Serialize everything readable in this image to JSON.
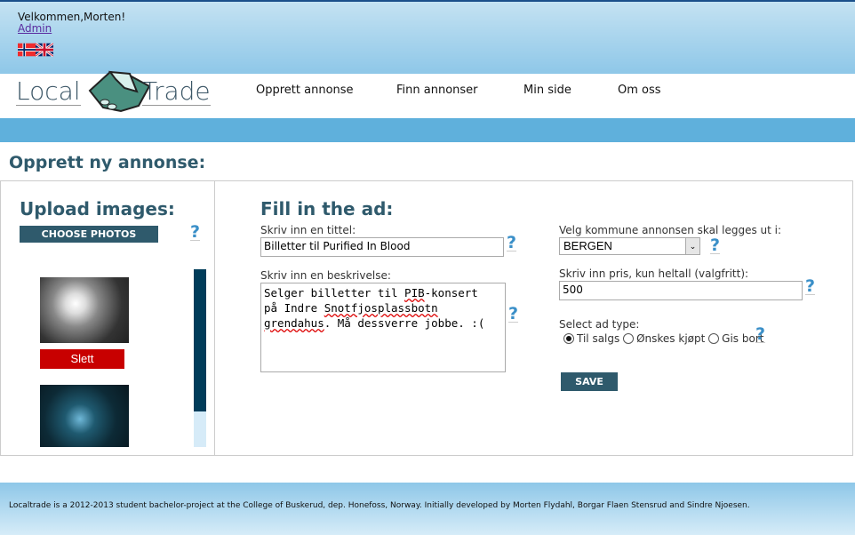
{
  "header": {
    "welcome": "Velkommen,Morten!",
    "admin_link": "Admin",
    "languages": [
      "norwegian-flag",
      "uk-flag"
    ]
  },
  "logo": {
    "text_left": "Local",
    "text_right": "Trade"
  },
  "nav": [
    {
      "label": "Opprett annonse"
    },
    {
      "label": "Finn annonser"
    },
    {
      "label": "Min side"
    },
    {
      "label": "Om oss"
    }
  ],
  "page_title": "Opprett ny annonse:",
  "upload": {
    "title": "Upload images:",
    "choose_label": "CHOOSE PHOTOS",
    "delete_label": "Slett",
    "help": "?",
    "scroll_position": 0.8
  },
  "form": {
    "title": "Fill in the ad:",
    "title_label": "Skriv inn en tittel:",
    "title_value": "Billetter til Purified In Blood",
    "desc_label": "Skriv inn en beskrivelse:",
    "desc_parts": [
      "Selger billetter til ",
      "PIB",
      "-konsert\npå Indre ",
      "Snotfjosplassbotn",
      "\n",
      "grendahus",
      ". Må dessverre jobbe. :("
    ],
    "kommune_label": "Velg kommune annonsen skal legges ut i:",
    "kommune_value": "BERGEN",
    "price_label": "Skriv inn pris, kun heltall (valgfritt):",
    "price_value": "500",
    "type_label": "Select ad type:",
    "types": [
      {
        "label": "Til salgs",
        "selected": true
      },
      {
        "label": "Ønskes kjøpt",
        "selected": false
      },
      {
        "label": "Gis bort",
        "selected": false
      }
    ],
    "save_label": "SAVE",
    "help": "?"
  },
  "footer": "Localtrade is a 2012-2013 student bachelor-project at the College of Buskerud, dep. Honefoss, Norway. Initially developed by Morten Flydahl, Borgar Flaen Stensrud and Sindre Njoesen.",
  "colors": {
    "accent": "#2f5a6c",
    "delete": "#c80000",
    "help": "#3a8fc8"
  }
}
